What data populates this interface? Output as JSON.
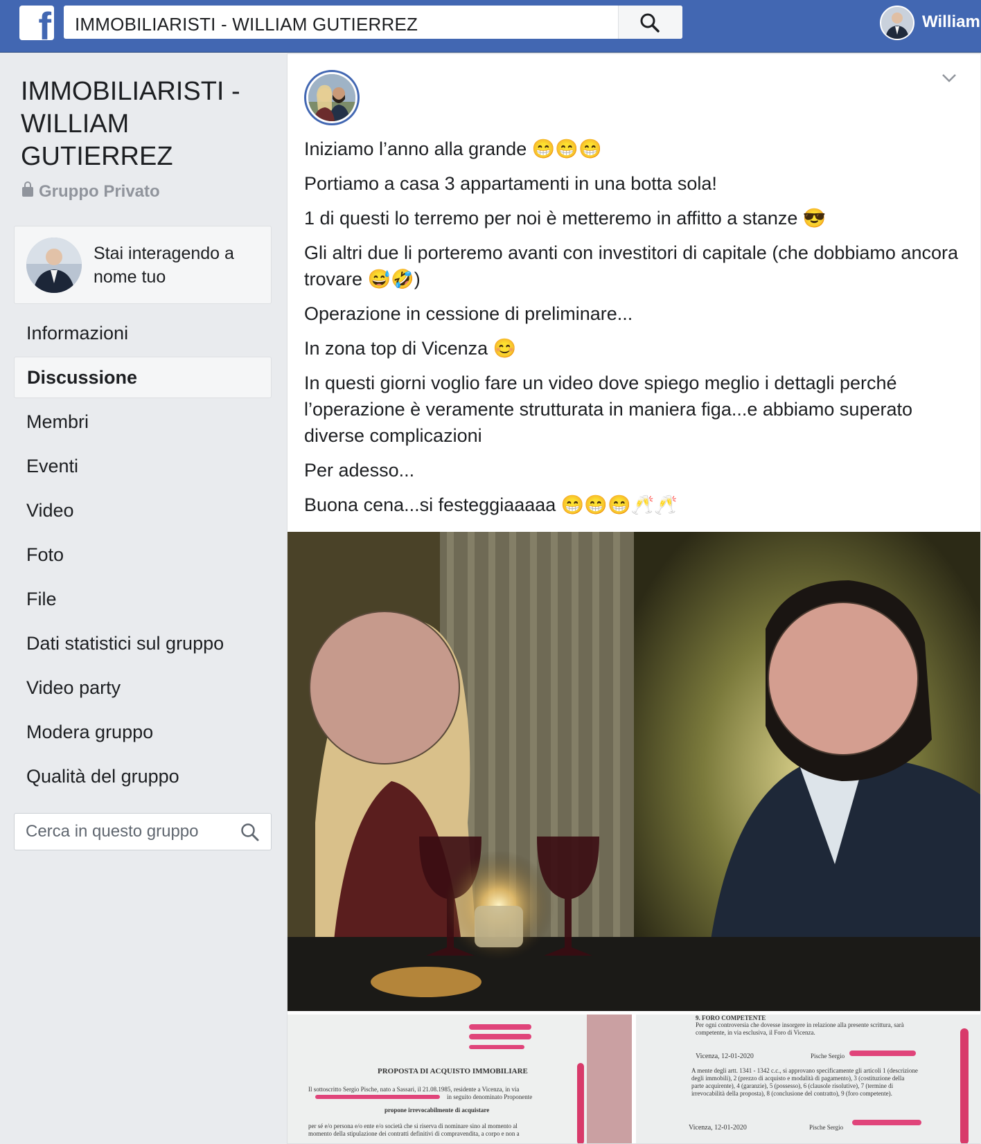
{
  "topbar": {
    "search_value": "IMMOBILIARISTI - WILLIAM GUTIERREZ",
    "user_name": "William",
    "brand_color": "#4267b2"
  },
  "sidebar": {
    "group_title": "IMMOBILIARISTI - WILLIAM GUTIERREZ",
    "privacy_label": "Gruppo Privato",
    "acting_as_text": "Stai interagendo a nome tuo",
    "nav": [
      {
        "label": "Informazioni",
        "active": false
      },
      {
        "label": "Discussione",
        "active": true
      },
      {
        "label": "Membri",
        "active": false
      },
      {
        "label": "Eventi",
        "active": false
      },
      {
        "label": "Video",
        "active": false
      },
      {
        "label": "Foto",
        "active": false
      },
      {
        "label": "File",
        "active": false
      },
      {
        "label": "Dati statistici sul gruppo",
        "active": false
      },
      {
        "label": "Video party",
        "active": false
      },
      {
        "label": "Modera gruppo",
        "active": false
      },
      {
        "label": "Qualità del gruppo",
        "active": false
      }
    ],
    "group_search_placeholder": "Cerca in questo gruppo"
  },
  "post": {
    "paragraphs": [
      "Iniziamo l’anno alla grande 😁😁😁",
      "Portiamo a casa 3 appartamenti in una botta sola!",
      "1 di questi lo terremo per noi è metteremo in affitto a stanze 😎",
      "Gli altri due li porteremo avanti con investitori di capitale (che dobbiamo ancora trovare 😅🤣)",
      "Operazione in cessione di preliminare...",
      "In zona top di Vicenza 😊",
      "In questi giorni voglio fare un video dove spiego meglio i dettagli perché l’operazione è veramente strutturata in maniera figa...e abbiamo superato diverse complicazioni",
      "Per adesso...",
      "Buona cena...si festeggiaaaaa 😁😁😁🥂🥂"
    ],
    "doc1": {
      "heading": "PROPOSTA DI ACQUISTO IMMOBILIARE",
      "line1": "Il sottoscritto Sergio Pische, nato a Sassari, il 21.08.1985, residente a Vicenza, in via",
      "line2": "in seguito denominato Proponente",
      "subheading": "propone irrevocabilmente di acquistare",
      "line3": "per sé e/o persona e/o ente e/o società che si riserva di nominare sino al momento al",
      "line4": "momento della stipulazione dei contratti definitivi di compravendita, a corpo e non a"
    },
    "doc2": {
      "heading": "9. FORO COMPETENTE",
      "line1": "Per ogni controversia che dovesse insorgere in relazione alla presente scrittura, sarà",
      "line2": "competente, in via esclusiva, il Foro di Vicenza.",
      "place_date_1": "Vicenza, 12-01-2020",
      "signer_1": "Pische Sergio",
      "line3": "A mente degli artt. 1341 - 1342 c.c., si approvano specificamente gli articoli 1 (descrizione",
      "line4": "degli immobili), 2 (prezzo di acquisto e modalità di pagamento), 3 (costituzione della",
      "line5": "parte acquirente), 4 (garanzie), 5 (possesso), 6 (clausole risolutive), 7 (termine di",
      "line6": "irrevocabilità della proposta), 8 (conclusione del contratto), 9 (foro competente).",
      "place_date_2": "Vicenza, 12-01-2020",
      "signer_2": "Pische Sergio"
    }
  }
}
